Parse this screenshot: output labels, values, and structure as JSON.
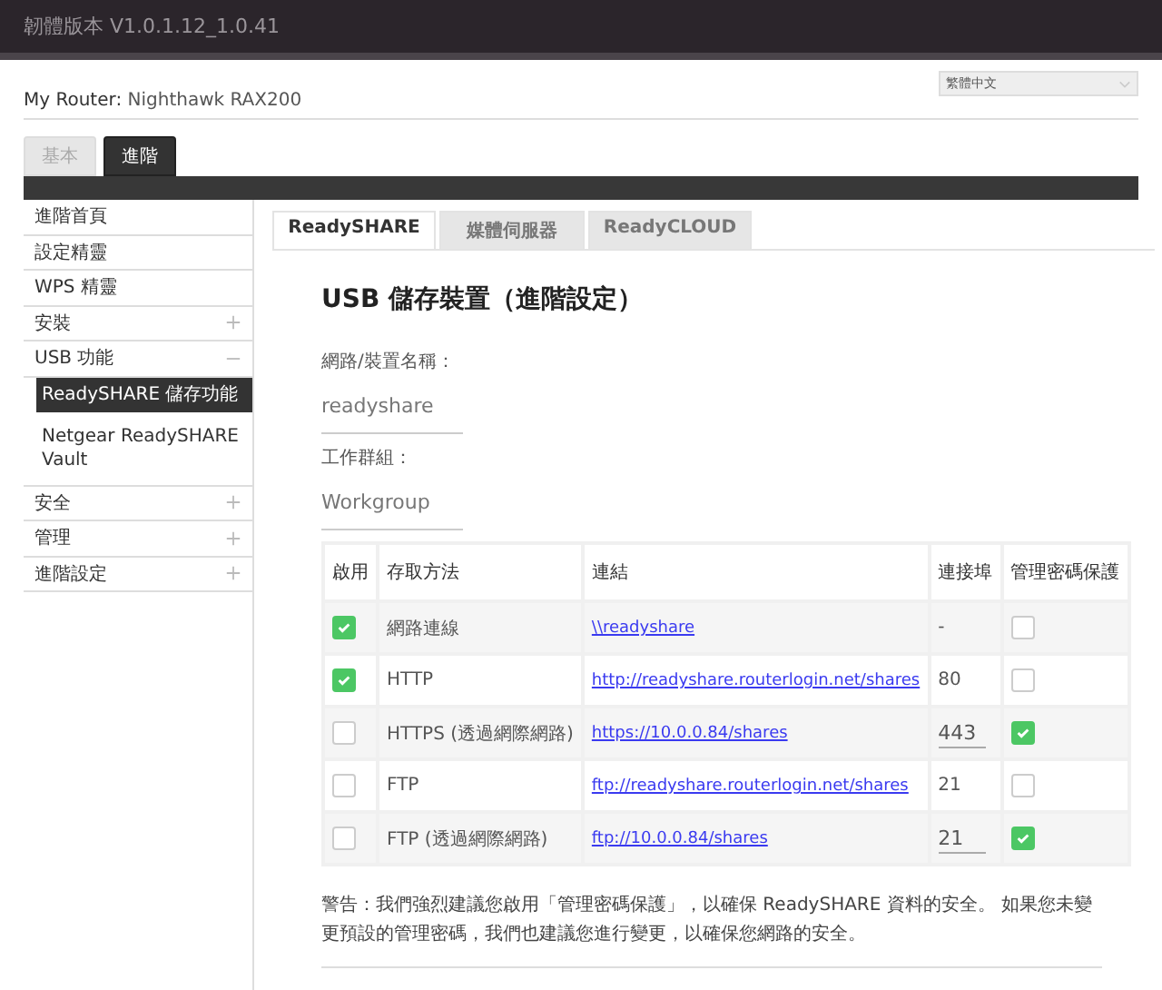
{
  "firmware": "韌體版本 V1.0.1.12_1.0.41",
  "language": {
    "value": "繁體中文"
  },
  "router": {
    "label": "My Router:",
    "name": "Nighthawk RAX200"
  },
  "main_tabs": [
    {
      "label": "基本",
      "selected": false
    },
    {
      "label": "進階",
      "selected": true
    }
  ],
  "sidebar": {
    "items": [
      {
        "label": "進階首頁"
      },
      {
        "label": "設定精靈"
      },
      {
        "label": "WPS 精靈"
      },
      {
        "label": "安裝",
        "expanded": false
      },
      {
        "label": "USB 功能",
        "expanded": true,
        "children": [
          {
            "label": "ReadySHARE 儲存功能",
            "selected": true
          },
          {
            "label": "Netgear ReadySHARE Vault",
            "selected": false
          }
        ]
      },
      {
        "label": "安全",
        "expanded": false
      },
      {
        "label": "管理",
        "expanded": false
      },
      {
        "label": "進階設定",
        "expanded": false
      }
    ]
  },
  "content_tabs": [
    {
      "label": "ReadySHARE",
      "selected": true
    },
    {
      "label": "媒體伺服器",
      "selected": false
    },
    {
      "label": "ReadyCLOUD",
      "selected": false
    }
  ],
  "heading": "USB 儲存裝置（進階設定）",
  "fields": [
    {
      "label": "網路/裝置名稱：",
      "value": "readyshare"
    },
    {
      "label": "工作群組：",
      "value": "Workgroup"
    }
  ],
  "table": {
    "columns": [
      "啟用",
      "存取方法",
      "連結",
      "連接埠",
      "管理密碼保護"
    ],
    "rows": [
      {
        "enabled": true,
        "method": "網路連線",
        "link": "\\\\readyshare",
        "port": "-",
        "port_editable": false,
        "password": false
      },
      {
        "enabled": true,
        "method": "HTTP",
        "link": "http://readyshare.routerlogin.net/shares",
        "port": "80",
        "port_editable": false,
        "password": false
      },
      {
        "enabled": false,
        "method": "HTTPS (透過網際網路)",
        "link": "https://10.0.0.84/shares",
        "port": "443",
        "port_editable": true,
        "password": true
      },
      {
        "enabled": false,
        "method": "FTP",
        "link": "ftp://readyshare.routerlogin.net/shares",
        "port": "21",
        "port_editable": false,
        "password": false
      },
      {
        "enabled": false,
        "method": "FTP (透過網際網路)",
        "link": "ftp://10.0.0.84/shares",
        "port": "21",
        "port_editable": true,
        "password": true
      }
    ]
  },
  "warning": "警告：我們強烈建議您啟用「管理密碼保護」，以確保 ReadySHARE 資料的安全。 如果您未變更預設的管理密碼，我們也建議您進行變更，以確保您網路的安全。"
}
